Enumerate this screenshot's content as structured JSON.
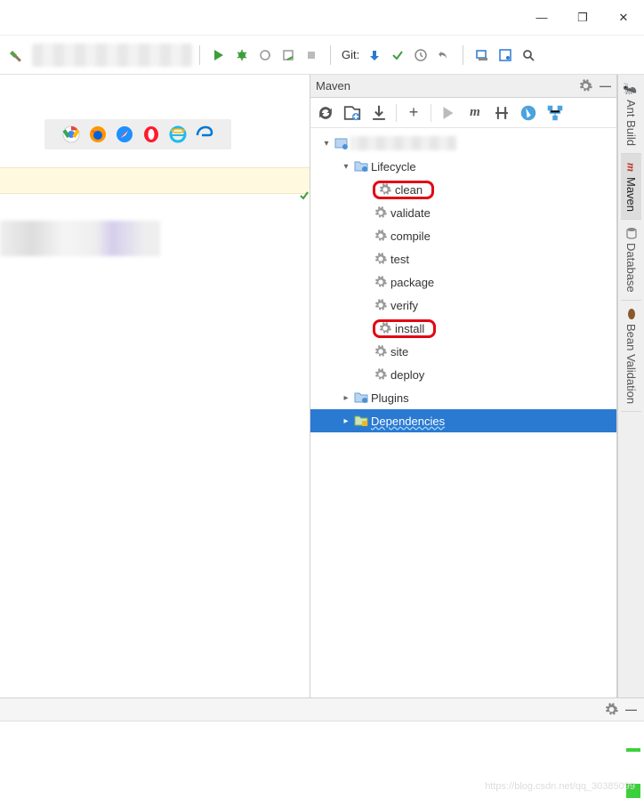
{
  "window": {
    "min": "—",
    "restore": "❐",
    "close": "✕"
  },
  "toolbar": {
    "git_label": "Git:"
  },
  "maven": {
    "title": "Maven",
    "tree": {
      "root_expanded": true,
      "lifecycle_label": "Lifecycle",
      "plugins_label": "Plugins",
      "dependencies_label": "Dependencies",
      "goals": [
        "clean",
        "validate",
        "compile",
        "test",
        "package",
        "verify",
        "install",
        "site",
        "deploy"
      ],
      "highlighted_goals": [
        "clean",
        "install"
      ],
      "selected": "Dependencies"
    }
  },
  "side_tabs": {
    "ant": "Ant Build",
    "maven": "Maven",
    "database": "Database",
    "bean": "Bean Validation"
  },
  "watermark": "https://blog.csdn.net/qq_30385099"
}
